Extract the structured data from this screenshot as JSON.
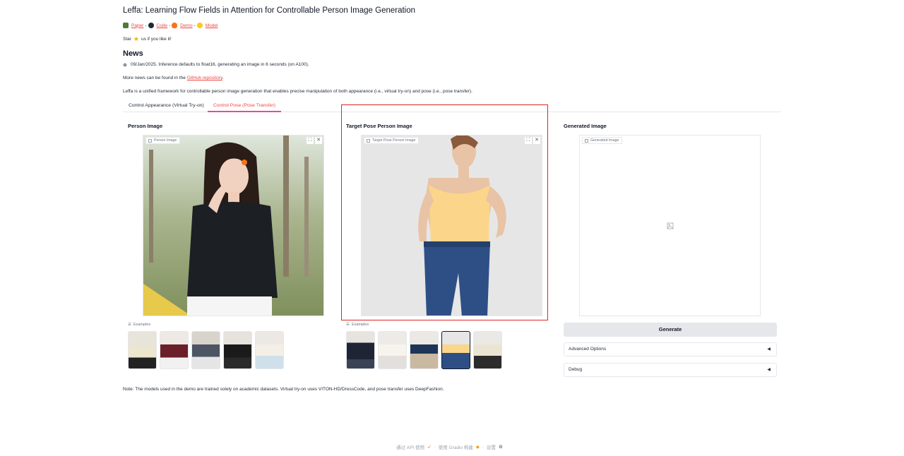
{
  "header": {
    "title": "Leffa: Learning Flow Fields in Attention for Controllable Person Image Generation",
    "links": [
      {
        "label": "Paper",
        "icon": "paper-icon"
      },
      {
        "label": "Code",
        "icon": "github-icon"
      },
      {
        "label": "Demo",
        "icon": "fire-icon"
      },
      {
        "label": "Model",
        "icon": "hugging-face-icon"
      }
    ],
    "separator": " - ",
    "star_prefix": "Star",
    "star_suffix": "us if you like it!"
  },
  "news": {
    "heading": "News",
    "items": [
      "09/Jan/2025. Inference defaults to float16, generating an image in 6 seconds (on A100)."
    ],
    "more_prefix": "More news can be found in the",
    "more_link": "GitHub repository",
    "more_suffix": "."
  },
  "description": "Leffa is a unified framework for controllable person image generation that enables precise manipulation of both appearance (i.e., virtual try-on) and pose (i.e., pose transfer).",
  "tabs": [
    {
      "label": "Control Appearance (Virtual Try-on)",
      "active": false
    },
    {
      "label": "Control Pose (Pose Transfer)",
      "active": true
    }
  ],
  "columns": {
    "person": {
      "heading": "Person Image",
      "label": "Person Image",
      "examples_label": "Examples"
    },
    "target": {
      "heading": "Target Pose Person Image",
      "label": "Target Pose Person Image",
      "examples_label": "Examples"
    },
    "generated": {
      "heading": "Generated Image",
      "label": "Generated Image"
    }
  },
  "actions": {
    "generate": "Generate",
    "advanced": "Advanced Options",
    "debug": "Debug",
    "collapse_glyph": "◀"
  },
  "note": "Note: The models used in the demo are trained solely on academic datasets. Virtual try-on uses VITON-HD/DressCode, and pose transfer uses DeepFashion.",
  "footer": {
    "api": "通过 API 使用",
    "built": "使用 Gradio 构建",
    "settings": "设置",
    "dot": "·"
  },
  "colors": {
    "accent": "#ef4444",
    "tab_underline": "#ec4899",
    "highlight_box": "#dc2626"
  }
}
